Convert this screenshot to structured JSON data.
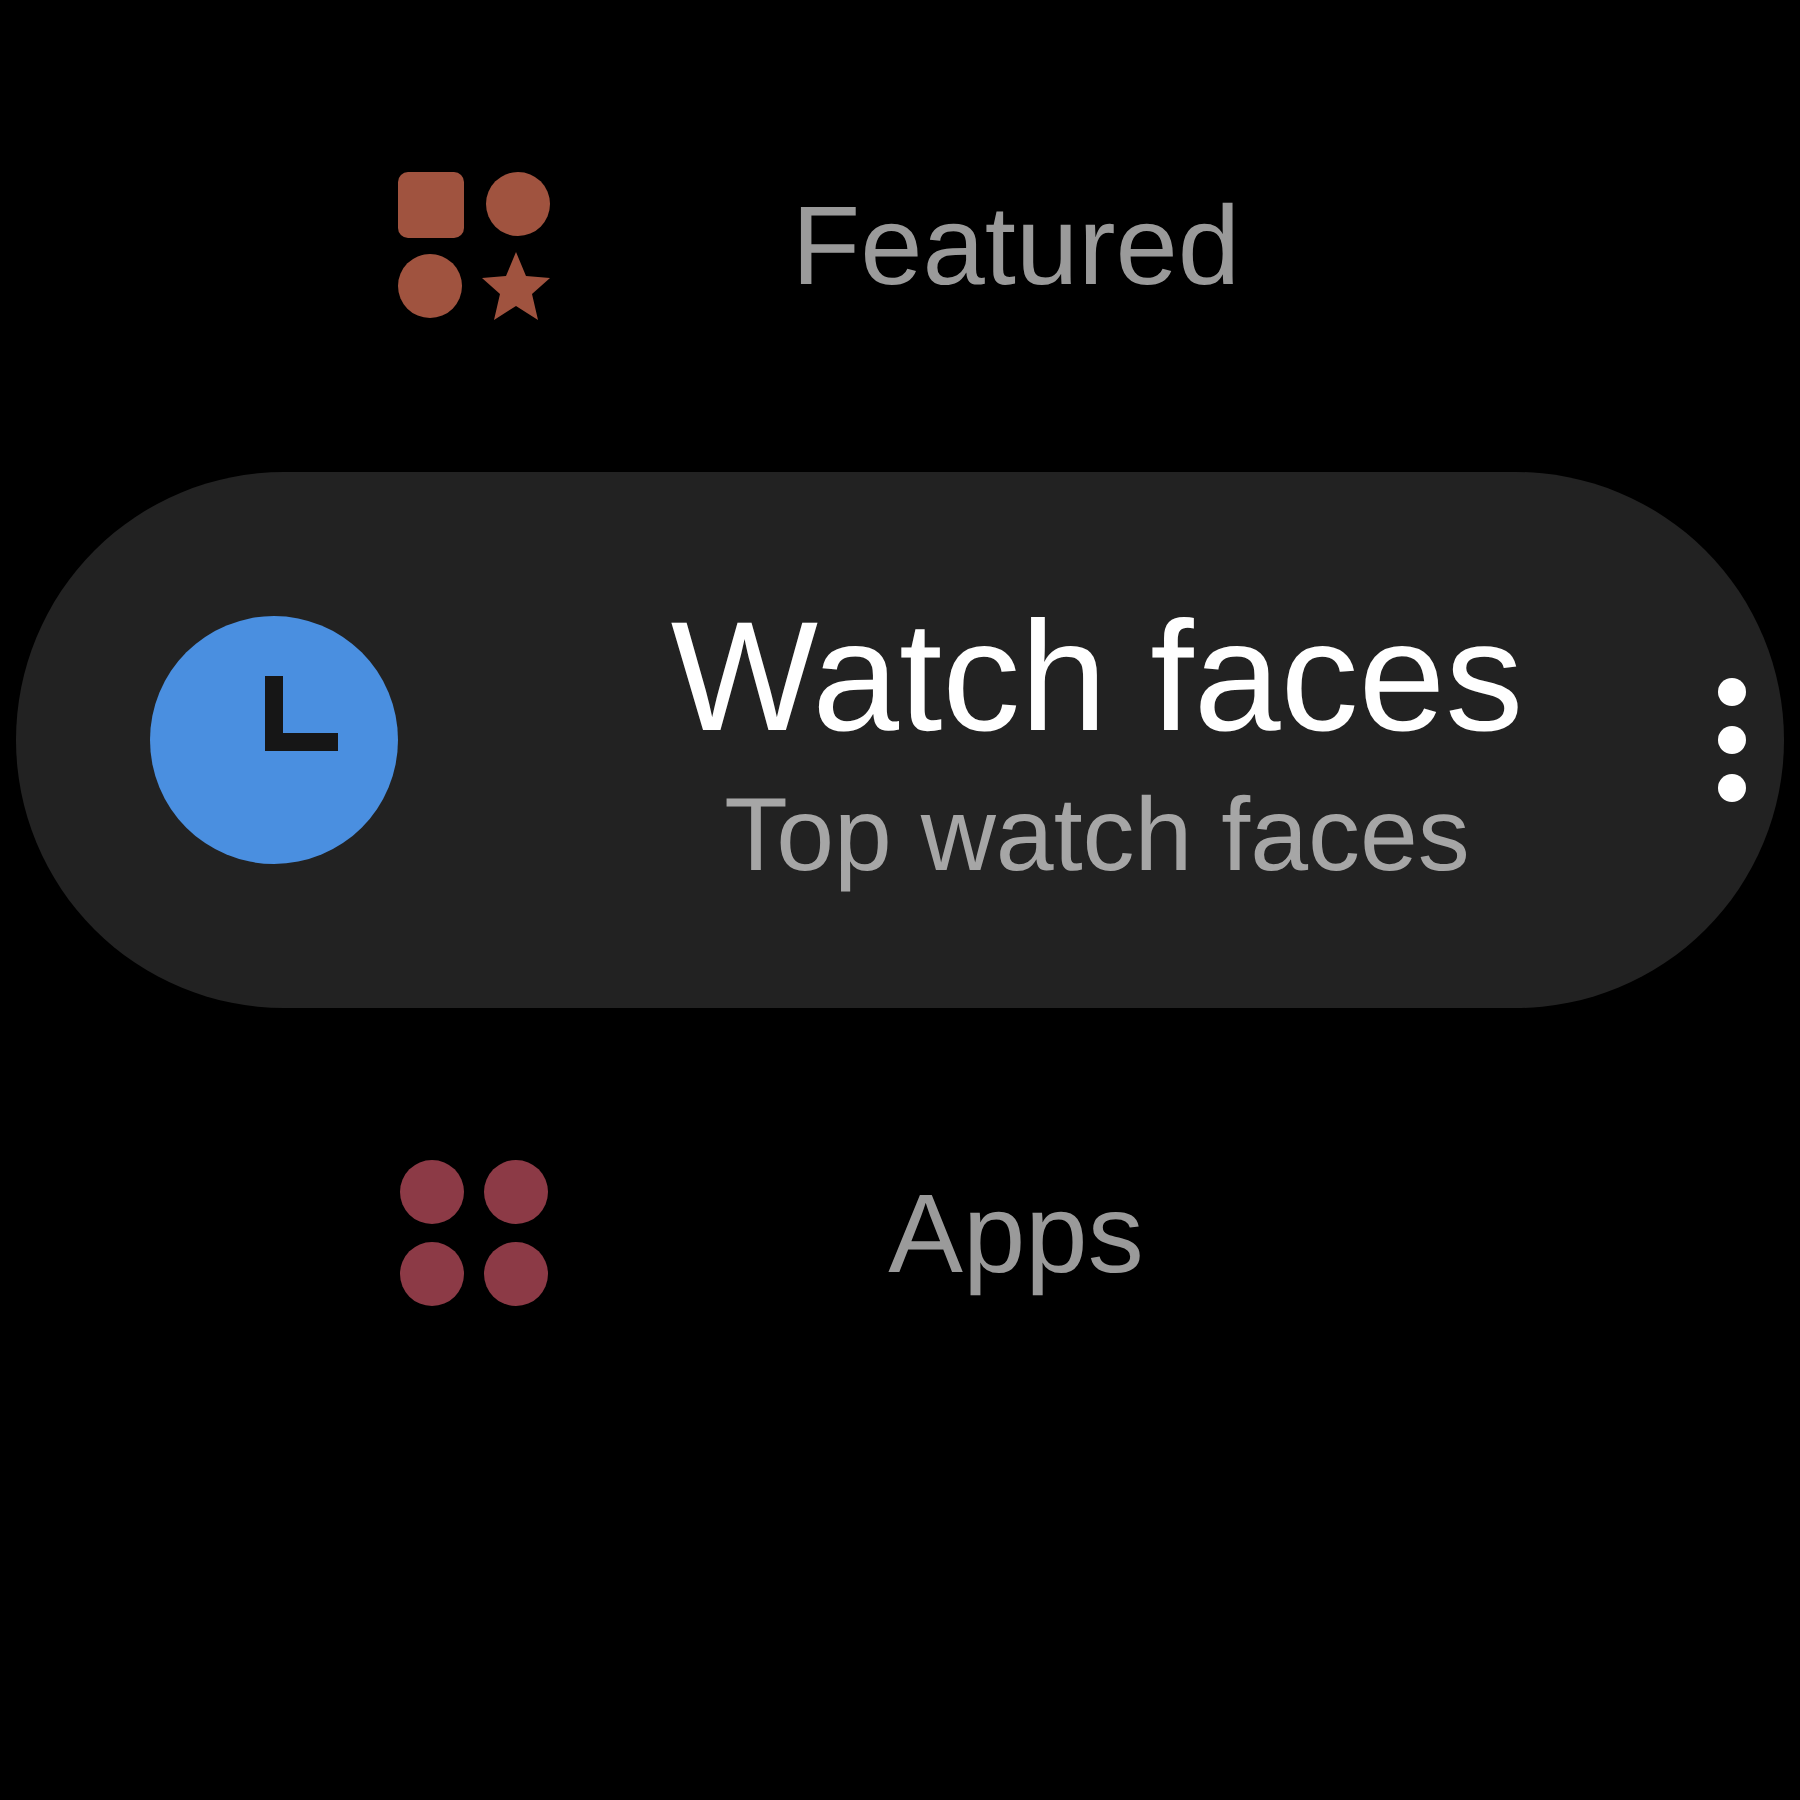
{
  "items": [
    {
      "kind": "shapes",
      "title": "Featured",
      "color": "#a0533f",
      "selected": false
    },
    {
      "kind": "clock",
      "title": "Watch faces",
      "subtitle": "Top watch faces",
      "color": "#4a8fe0",
      "selected": true
    },
    {
      "kind": "grid",
      "title": "Apps",
      "color": "#8c3a46",
      "selected": false
    }
  ]
}
